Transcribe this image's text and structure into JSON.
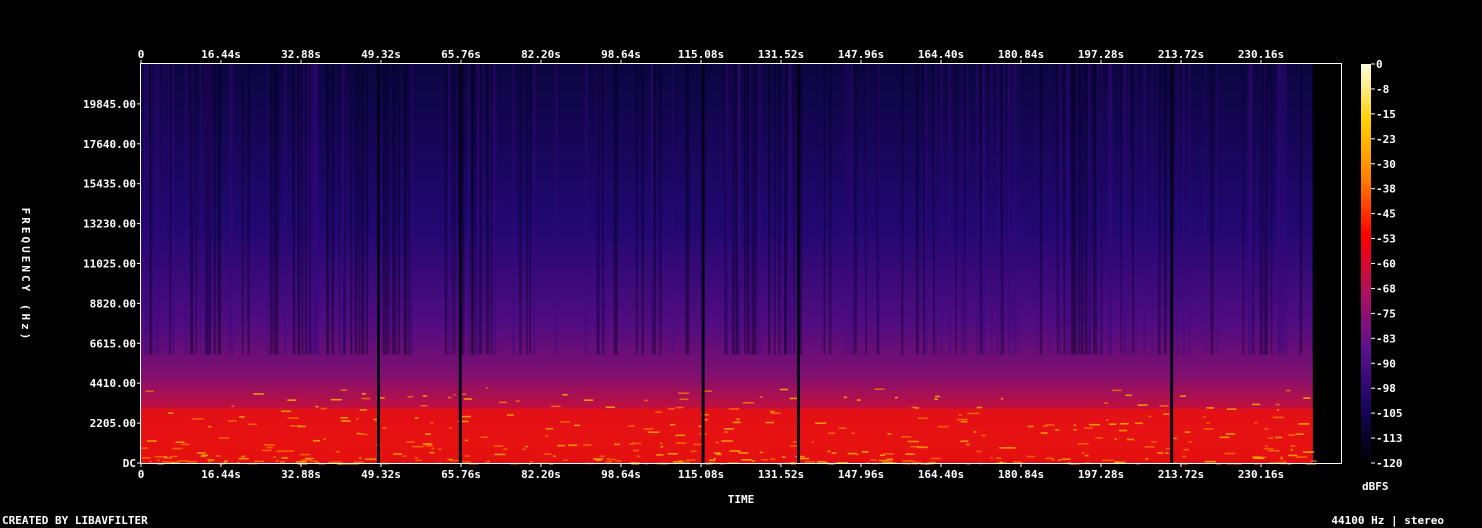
{
  "chart_data": {
    "type": "heatmap",
    "title": "",
    "xlabel": "TIME",
    "ylabel": "FREQUENCY (Hz)",
    "x_ticks": [
      "0",
      "16.44s",
      "32.88s",
      "49.32s",
      "65.76s",
      "82.20s",
      "98.64s",
      "115.08s",
      "131.52s",
      "147.96s",
      "164.40s",
      "180.84s",
      "197.28s",
      "213.72s",
      "230.16s"
    ],
    "x_tick_values": [
      0,
      16.44,
      32.88,
      49.32,
      65.76,
      82.2,
      98.64,
      115.08,
      131.52,
      147.96,
      164.4,
      180.84,
      197.28,
      213.72,
      230.16
    ],
    "xlim": [
      0,
      246.6
    ],
    "y_ticks": [
      "DC",
      "2205.00",
      "4410.00",
      "6615.00",
      "8820.00",
      "11025.00",
      "13230.00",
      "15435.00",
      "17640.00",
      "19845.00"
    ],
    "y_tick_values": [
      0,
      2205,
      4410,
      6615,
      8820,
      11025,
      13230,
      15435,
      17640,
      19845
    ],
    "ylim": [
      0,
      22050
    ],
    "colorbar": {
      "label": "dBFS",
      "ticks": [
        "0",
        "-8",
        "-15",
        "-23",
        "-30",
        "-38",
        "-45",
        "-53",
        "-60",
        "-68",
        "-75",
        "-83",
        "-90",
        "-98",
        "-105",
        "-113",
        "-120"
      ],
      "range": [
        -120,
        0
      ],
      "colors": [
        "#000000",
        "#1a0560",
        "#5a1090",
        "#b01060",
        "#ff0000",
        "#ff8000",
        "#ffd000",
        "#ffffe0"
      ]
    },
    "energy_profile_khz_cutoff": {
      "description_free_values": [
        {
          "t": 0,
          "level": 0.25
        },
        {
          "t": 49,
          "level": 0.2
        },
        {
          "t": 115,
          "level": 0.2
        },
        {
          "t": 148,
          "level": 0.3
        },
        {
          "t": 240,
          "level": 0.25
        }
      ],
      "dark_gaps_s": [
        48.5,
        65.3,
        115.2,
        134.8,
        211.5
      ],
      "end_s": 240.8
    }
  },
  "footer": {
    "left": "CREATED BY LIBAVFILTER",
    "right": "44100 Hz | stereo"
  }
}
